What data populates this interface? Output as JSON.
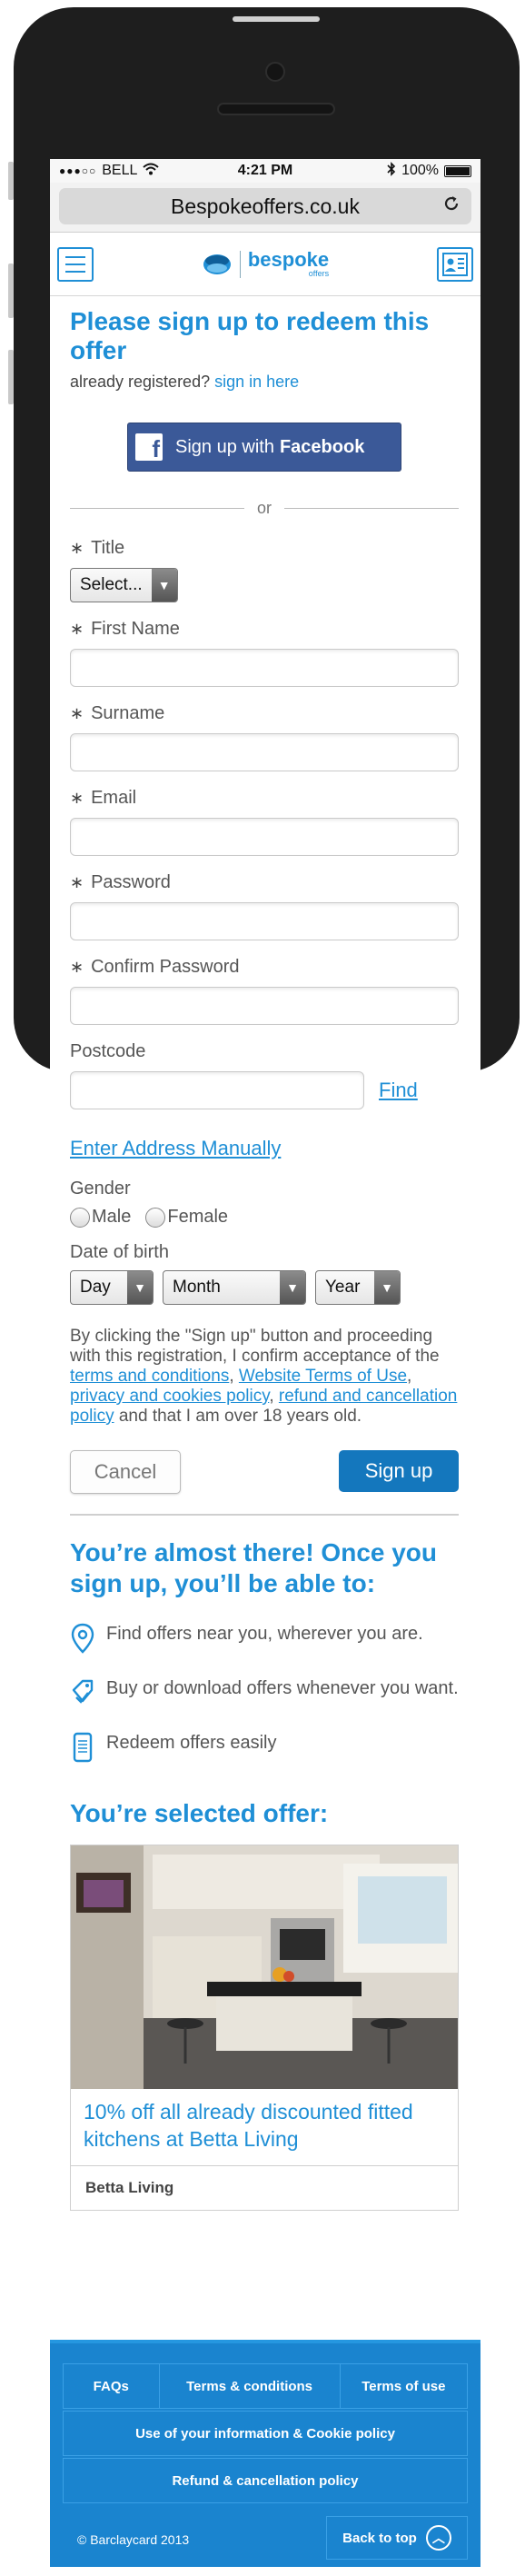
{
  "status_bar": {
    "carrier": "BELL",
    "time": "4:21 PM",
    "battery": "100%",
    "battery_level": 1.0
  },
  "browser": {
    "url": "Bespokeoffers.co.uk"
  },
  "site": {
    "logo_name": "bespoke",
    "logo_sub": "offers"
  },
  "form": {
    "heading": "Please sign up to redeem this offer",
    "already_text": "already registered?",
    "sign_in_link": "sign in here",
    "facebook_prefix": "Sign up with",
    "facebook_brand": "Facebook",
    "or_text": "or",
    "required_marker": "∗",
    "title_label": "Title",
    "title_select": "Select...",
    "first_name_label": "First Name",
    "surname_label": "Surname",
    "email_label": "Email",
    "password_label": "Password",
    "confirm_password_label": "Confirm Password",
    "postcode_label": "Postcode",
    "find_link": "Find",
    "manual_link": "Enter Address Manually",
    "gender_label": "Gender",
    "gender_male": "Male",
    "gender_female": "Female",
    "dob_label": "Date of birth",
    "dob_day": "Day",
    "dob_month": "Month",
    "dob_year": "Year",
    "legal_1": "By clicking the \"Sign up\" button and proceeding with this registration, I confirm acceptance of the",
    "legal_link_terms": "terms and conditions",
    "legal_comma1": ",",
    "legal_link_website": "Website Terms of Use",
    "legal_comma2": ",",
    "legal_link_privacy": "privacy and cookies policy",
    "legal_comma3": ",",
    "legal_link_refund": "refund and cancellation policy",
    "legal_2": "and that I am over 18 years old.",
    "cancel_button": "Cancel",
    "signup_button": "Sign up"
  },
  "benefits": {
    "heading": "You’re almost there! Once you sign up, you’ll be able to:",
    "items": [
      {
        "icon": "location-pin-icon",
        "text": "Find offers near you, wherever you are."
      },
      {
        "icon": "tag-icon",
        "text": "Buy or download offers whenever you want."
      },
      {
        "icon": "phone-icon",
        "text": "Redeem offers easily"
      }
    ]
  },
  "offer": {
    "heading": "You’re selected offer:",
    "caption": "10% off all already discounted fitted kitchens at Betta Living",
    "brand": "Betta Living"
  },
  "footer": {
    "faqs": "FAQs",
    "terms": "Terms & conditions",
    "terms_of_use": "Terms of use",
    "cookie_policy": "Use of your information & Cookie policy",
    "refund_policy": "Refund & cancellation policy",
    "copyright": "© Barclaycard 2013",
    "back_to_top": "Back to top"
  },
  "colors": {
    "brand_blue": "#1f8fd6",
    "facebook_blue": "#3b5998",
    "signup_blue": "#1477bd",
    "footer_blue": "#1a84cf"
  }
}
